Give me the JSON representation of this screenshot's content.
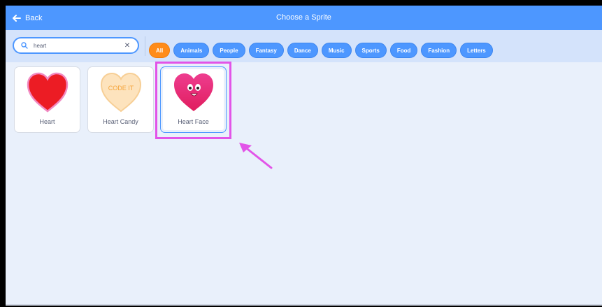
{
  "header": {
    "back_label": "Back",
    "title": "Choose a Sprite"
  },
  "search": {
    "value": "heart"
  },
  "filters": [
    {
      "label": "All",
      "active": true
    },
    {
      "label": "Animals",
      "active": false
    },
    {
      "label": "People",
      "active": false
    },
    {
      "label": "Fantasy",
      "active": false
    },
    {
      "label": "Dance",
      "active": false
    },
    {
      "label": "Music",
      "active": false
    },
    {
      "label": "Sports",
      "active": false
    },
    {
      "label": "Food",
      "active": false
    },
    {
      "label": "Fashion",
      "active": false
    },
    {
      "label": "Letters",
      "active": false
    }
  ],
  "sprites": [
    {
      "label": "Heart",
      "icon": "heart-icon"
    },
    {
      "label": "Heart Candy",
      "icon": "heart-candy-icon",
      "candy_text": "CODE IT"
    },
    {
      "label": "Heart Face",
      "icon": "heart-face-icon",
      "selected": true
    }
  ],
  "colors": {
    "header": "#4d97ff",
    "active_filter": "#ff8c1a",
    "highlight": "#e254e8"
  }
}
